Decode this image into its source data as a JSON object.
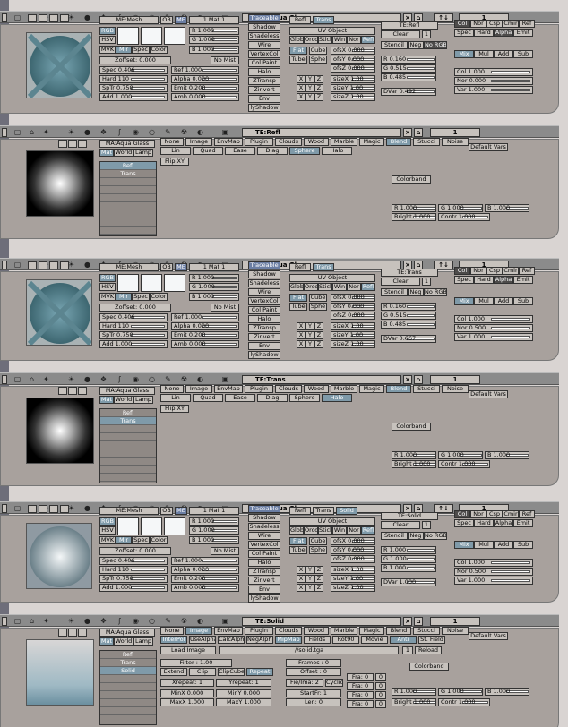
{
  "sections": [
    {
      "top_header": {
        "title": "MA:Aqua Glass",
        "num": "1",
        "sep": "Sep!"
      },
      "mat": {
        "me_label": "ME:Mesh",
        "ob": "OB",
        "me": "ME",
        "mat_num": "1 Mat 1",
        "rgb": "RGB",
        "hsv": "HSV",
        "mode_row": [
          "MVK",
          "Mir",
          "Spec",
          "Color"
        ],
        "r": "R 1.000",
        "g": "G 1.000",
        "b": "B 1.000",
        "zoffs": "Zoffset: 0.000",
        "nomist": "No Mist",
        "spec": "Spec 0.406",
        "hard": "Hard 110",
        "sptr": "SpTr 0.750",
        "add": "Add 1.000",
        "ref": "Ref 1.000",
        "alpha": "Alpha 0.000",
        "emit": "Emit 0.200",
        "amb": "Amb 0.000",
        "mid": [
          "Traceable",
          "Shadow",
          "Shadeless",
          "Wire",
          "VertexCol",
          "Col Paint",
          "Halo",
          "ZTransp",
          "Zinvert",
          "Env",
          "lyShadow"
        ],
        "tabs": [
          "Refl",
          "Trans"
        ],
        "uv": "UV Object",
        "maprow": [
          "Glob",
          "Orco",
          "Stick",
          "Win",
          "Nor",
          "Refl"
        ],
        "flat": "Flat",
        "cube": "Cube",
        "tube": "Tube",
        "sphe": "Sphe",
        "ofs": [
          "ofsX 0.000",
          "ofsY 0.000",
          "ofsZ 0.000"
        ],
        "size": [
          "sizeX 1.00",
          "sizeY 1.00",
          "sizeZ 1.00"
        ],
        "xyz": [
          "X",
          "Y",
          "Z"
        ],
        "te": "TE:Refl",
        "clear": "Clear",
        "one": "1",
        "stencil": [
          "Stencil",
          "Neg",
          "No RGB"
        ],
        "rgbv": [
          "R 0.160",
          "G 0.515",
          "B 0.485"
        ],
        "dvar": "DVar 0.492",
        "right1": [
          "Col",
          "Nor",
          "Csp",
          "Cmir",
          "Ref"
        ],
        "right2": [
          "Spec",
          "Hard",
          "Alpha",
          "Emit"
        ],
        "blend": [
          "Mix",
          "Mul",
          "Add",
          "Sub"
        ],
        "colv": [
          "Col 1.000",
          "Nor 0.000",
          "Var 1.000"
        ]
      },
      "tex_header": {
        "title": "TE:Refl",
        "num": "1"
      },
      "tex": {
        "ma": "MA:Aqua Glass",
        "src": [
          "Mat",
          "World",
          "Lamp"
        ],
        "types1": [
          "None",
          "Image",
          "EnvMap",
          "Plugin",
          "Clouds",
          "Wood",
          "Marble",
          "Magic",
          "Blend",
          "Stucci",
          "Noise"
        ],
        "types2": [
          "Lin",
          "Quad",
          "Ease",
          "Diag",
          "Sphere",
          "Halo"
        ],
        "default": "Default Vars",
        "list": [
          "Refl",
          "Trans",
          "",
          "",
          "",
          "",
          "",
          "",
          ""
        ],
        "flip": "Flip XY",
        "colorband": "Colorband",
        "rgb": [
          "R 1.000",
          "G 1.000",
          "B 1.000"
        ],
        "bright": "Bright 1.000",
        "contr": "Contr 1.000"
      }
    },
    {
      "top_header": {
        "title": "MA:Aqua Glass",
        "num": "1",
        "sep": "Sep!"
      },
      "mat": {
        "me_label": "ME:Mesh",
        "ob": "OB",
        "me": "ME",
        "mat_num": "1 Mat 1",
        "rgb": "RGB",
        "hsv": "HSV",
        "mode_row": [
          "MVK",
          "Mir",
          "Spec",
          "Color"
        ],
        "r": "R 1.000",
        "g": "G 1.000",
        "b": "B 1.000",
        "zoffs": "Zoffset: 0.000",
        "nomist": "No Mist",
        "spec": "Spec 0.406",
        "hard": "Hard 110",
        "sptr": "SpTr 0.750",
        "add": "Add 1.000",
        "ref": "Ref 1.000",
        "alpha": "Alpha 0.000",
        "emit": "Emit 0.200",
        "amb": "Amb 0.000",
        "mid": [
          "Traceable",
          "Shadow",
          "Shadeless",
          "Wire",
          "VertexCol",
          "Col Paint",
          "Halo",
          "ZTransp",
          "Zinvert",
          "Env",
          "lyShadow"
        ],
        "tabs": [
          "Refl",
          "Trans"
        ],
        "uv": "UV Object",
        "maprow": [
          "Glob",
          "Orco",
          "Stick",
          "Win",
          "Nor",
          "Refl"
        ],
        "flat": "Flat",
        "cube": "Cube",
        "tube": "Tube",
        "sphe": "Sphe",
        "ofs": [
          "ofsX 0.000",
          "ofsY 0.000",
          "ofsZ 0.000"
        ],
        "size": [
          "sizeX 1.00",
          "sizeY 1.00",
          "sizeZ 1.00"
        ],
        "xyz": [
          "X",
          "Y",
          "Z"
        ],
        "te": "TE:Trans",
        "clear": "Clear",
        "one": "1",
        "stencil": [
          "Stencil",
          "Neg",
          "No RGB"
        ],
        "rgbv": [
          "R 0.160",
          "G 0.515",
          "B 0.485"
        ],
        "dvar": "DVar 0.667",
        "right1": [
          "Col",
          "Nor",
          "Csp",
          "Cmir",
          "Ref"
        ],
        "right2": [
          "Spec",
          "Hard",
          "Alpha",
          "Emit"
        ],
        "blend": [
          "Mix",
          "Mul",
          "Add",
          "Sub"
        ],
        "colv": [
          "Col 1.000",
          "Nor 0.500",
          "Var 1.000"
        ]
      },
      "tex_header": {
        "title": "TE:Trans",
        "num": "1"
      },
      "tex": {
        "ma": "MA:Aqua Glass",
        "src": [
          "Mat",
          "World",
          "Lamp"
        ],
        "types1": [
          "None",
          "Image",
          "EnvMap",
          "Plugin",
          "Clouds",
          "Wood",
          "Marble",
          "Magic",
          "Blend",
          "Stucci",
          "Noise"
        ],
        "types2": [
          "Lin",
          "Quad",
          "Ease",
          "Diag",
          "Sphere",
          "Halo"
        ],
        "default": "Default Vars",
        "list": [
          "Refl",
          "Trans",
          "",
          "",
          "",
          "",
          "",
          "",
          ""
        ],
        "flip": "Flip XY",
        "colorband": "Colorband",
        "rgb": [
          "R 1.000",
          "G 1.000",
          "B 1.000"
        ],
        "bright": "Bright 1.000",
        "contr": "Contr 1.000"
      }
    },
    {
      "top_header": {
        "title": "MA:Aqua Glass",
        "num": "1",
        "sep": "SepT"
      },
      "mat": {
        "me_label": "ME:Mesh",
        "ob": "OB",
        "me": "ME",
        "mat_num": "1 Mat 1",
        "rgb": "RGB",
        "hsv": "HSV",
        "mode_row": [
          "MVK",
          "Mir",
          "Spec",
          "Color"
        ],
        "r": "R 1.000",
        "g": "G 1.000",
        "b": "B 1.000",
        "zoffs": "Zoffset: 0.000",
        "nomist": "No Mist",
        "spec": "Spec 0.406",
        "hard": "Hard 110",
        "sptr": "SpTr 0.750",
        "add": "Add 1.000",
        "ref": "Ref 1.000",
        "alpha": "Alpha 0.000",
        "emit": "Emit 0.200",
        "amb": "Amb 0.000",
        "mid": [
          "Traceable",
          "Shadow",
          "Shadeless",
          "Wire",
          "VertexCol",
          "Col Paint",
          "Halo",
          "ZTransp",
          "Zinvert",
          "Env",
          "lyShadow"
        ],
        "tabs": [
          "Refl",
          "Trans",
          "Solid"
        ],
        "uv": "UV Object",
        "maprow": [
          "Glob",
          "Orco",
          "Stick",
          "Win",
          "Nor",
          "Refl"
        ],
        "flat": "Flat",
        "cube": "Cube",
        "tube": "Tube",
        "sphe": "Sphe",
        "ofs": [
          "ofsX 0.000",
          "ofsY 0.000",
          "ofsZ 0.000"
        ],
        "size": [
          "sizeX 1.00",
          "sizeY 1.00",
          "sizeZ 1.00"
        ],
        "xyz": [
          "X",
          "Y",
          "Z"
        ],
        "te": "TE:Solid",
        "clear": "Clear",
        "one": "1",
        "stencil": [
          "Stencil",
          "Neg",
          "No RGB"
        ],
        "rgbv": [
          "R 1.000",
          "G 1.000",
          "B 1.000"
        ],
        "dvar": "DVar 1.000",
        "right1": [
          "Col",
          "Nor",
          "Csp",
          "Cmir",
          "Ref"
        ],
        "right2": [
          "Spec",
          "Hard",
          "Alpha",
          "Emit"
        ],
        "blend": [
          "Mix",
          "Mul",
          "Add",
          "Sub"
        ],
        "colv": [
          "Col 1.000",
          "Nor 0.500",
          "Var 1.000"
        ]
      },
      "tex_header": {
        "title": "TE:Solid",
        "num": "1"
      },
      "tex": {
        "ma": "MA:Aqua Glass",
        "src": [
          "Mat",
          "World",
          "Lamp"
        ],
        "types1": [
          "None",
          "Image",
          "EnvMap",
          "Plugin",
          "Clouds",
          "Wood",
          "Marble",
          "Magic",
          "Blend",
          "Stucci",
          "Noise"
        ],
        "types2": [
          "InterPol",
          "UseAlpha",
          "CalcAlpha",
          "NegAlpha",
          "MipMap",
          "Fields",
          "Rot90",
          "Movie",
          "Anti",
          "St. Field"
        ],
        "default": "Default Vars",
        "list": [
          "Refl",
          "Trans",
          "Solid",
          "",
          "",
          "",
          "",
          "",
          ""
        ],
        "loadimage": "Load Image",
        "path": "//solid.tga",
        "one": "1",
        "reload": "Reload",
        "filter": "Filter : 1.00",
        "frames": "Frames : 0",
        "offset": "Offset : 0",
        "ext": [
          "Extend",
          "Clip",
          "ClipCube",
          "Repeat"
        ],
        "xrep": "Xrepeat: 1",
        "yrep": "Yrepeat: 1",
        "fie": "Fie/Ima: 2",
        "cyclic": "Cyclic",
        "minx": "MinX 0.000",
        "miny": "MinY 0.000",
        "startfr": "StartFr: 1",
        "maxx": "MaxX 1.000",
        "maxy": "MaxY 1.000",
        "len": "Len: 0",
        "fra": [
          "Fra: 0",
          "Fra: 0",
          "Fra: 0",
          "Fra: 0"
        ],
        "zeros": [
          "0",
          "0",
          "0",
          "0"
        ],
        "colorband": "Colorband",
        "rgb": [
          "R 1.000",
          "G 1.000",
          "B 1.000"
        ],
        "bright": "Bright 1.000",
        "contr": "Contr 1.000"
      }
    }
  ]
}
